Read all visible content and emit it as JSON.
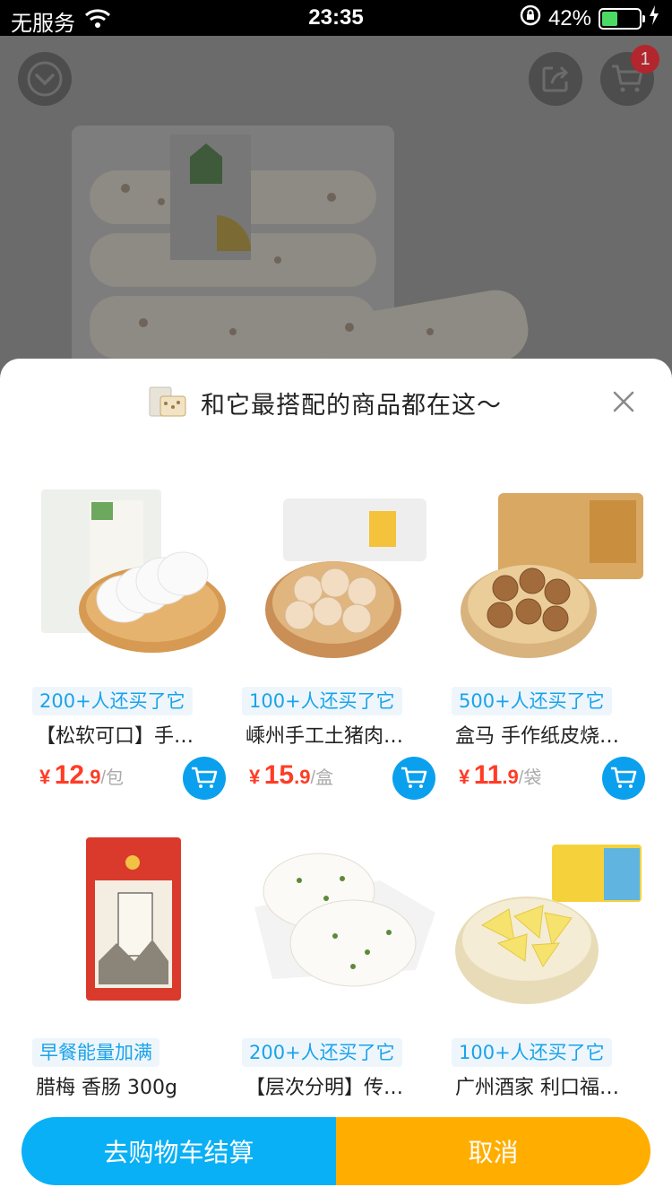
{
  "status_bar": {
    "carrier": "无服务",
    "time": "23:35",
    "battery": "42%",
    "battery_level": 0.42
  },
  "background_page": {
    "cart_badge_count": "1",
    "icons": [
      "chevron-down-icon",
      "share-icon",
      "cart-icon"
    ]
  },
  "sheet": {
    "title": "和它最搭配的商品都在这～",
    "close_icon": "close-icon",
    "products": [
      {
        "badge": "200+人还买了它",
        "name": "【松软可口】手…",
        "price_currency": "¥",
        "price_int": "12",
        "price_dec": ".9",
        "price_unit": "/包"
      },
      {
        "badge": "100+人还买了它",
        "name": "嵊州手工土猪肉…",
        "price_currency": "¥",
        "price_int": "15",
        "price_dec": ".9",
        "price_unit": "/盒"
      },
      {
        "badge": "500+人还买了它",
        "name": "盒马 手作纸皮烧…",
        "price_currency": "¥",
        "price_int": "11",
        "price_dec": ".9",
        "price_unit": "/袋"
      },
      {
        "badge": "早餐能量加满",
        "name": "腊梅 香肠 300g"
      },
      {
        "badge": "200+人还买了它",
        "name": "【层次分明】传…"
      },
      {
        "badge": "100+人还买了它",
        "name": "广州酒家 利口福…"
      }
    ],
    "checkout_label": "去购物车结算",
    "cancel_label": "取消"
  },
  "colors": {
    "accent_blue": "#0ab0f5",
    "accent_orange": "#ffae00",
    "price_red": "#ff3c26",
    "badge_text": "#1aa3ea"
  }
}
